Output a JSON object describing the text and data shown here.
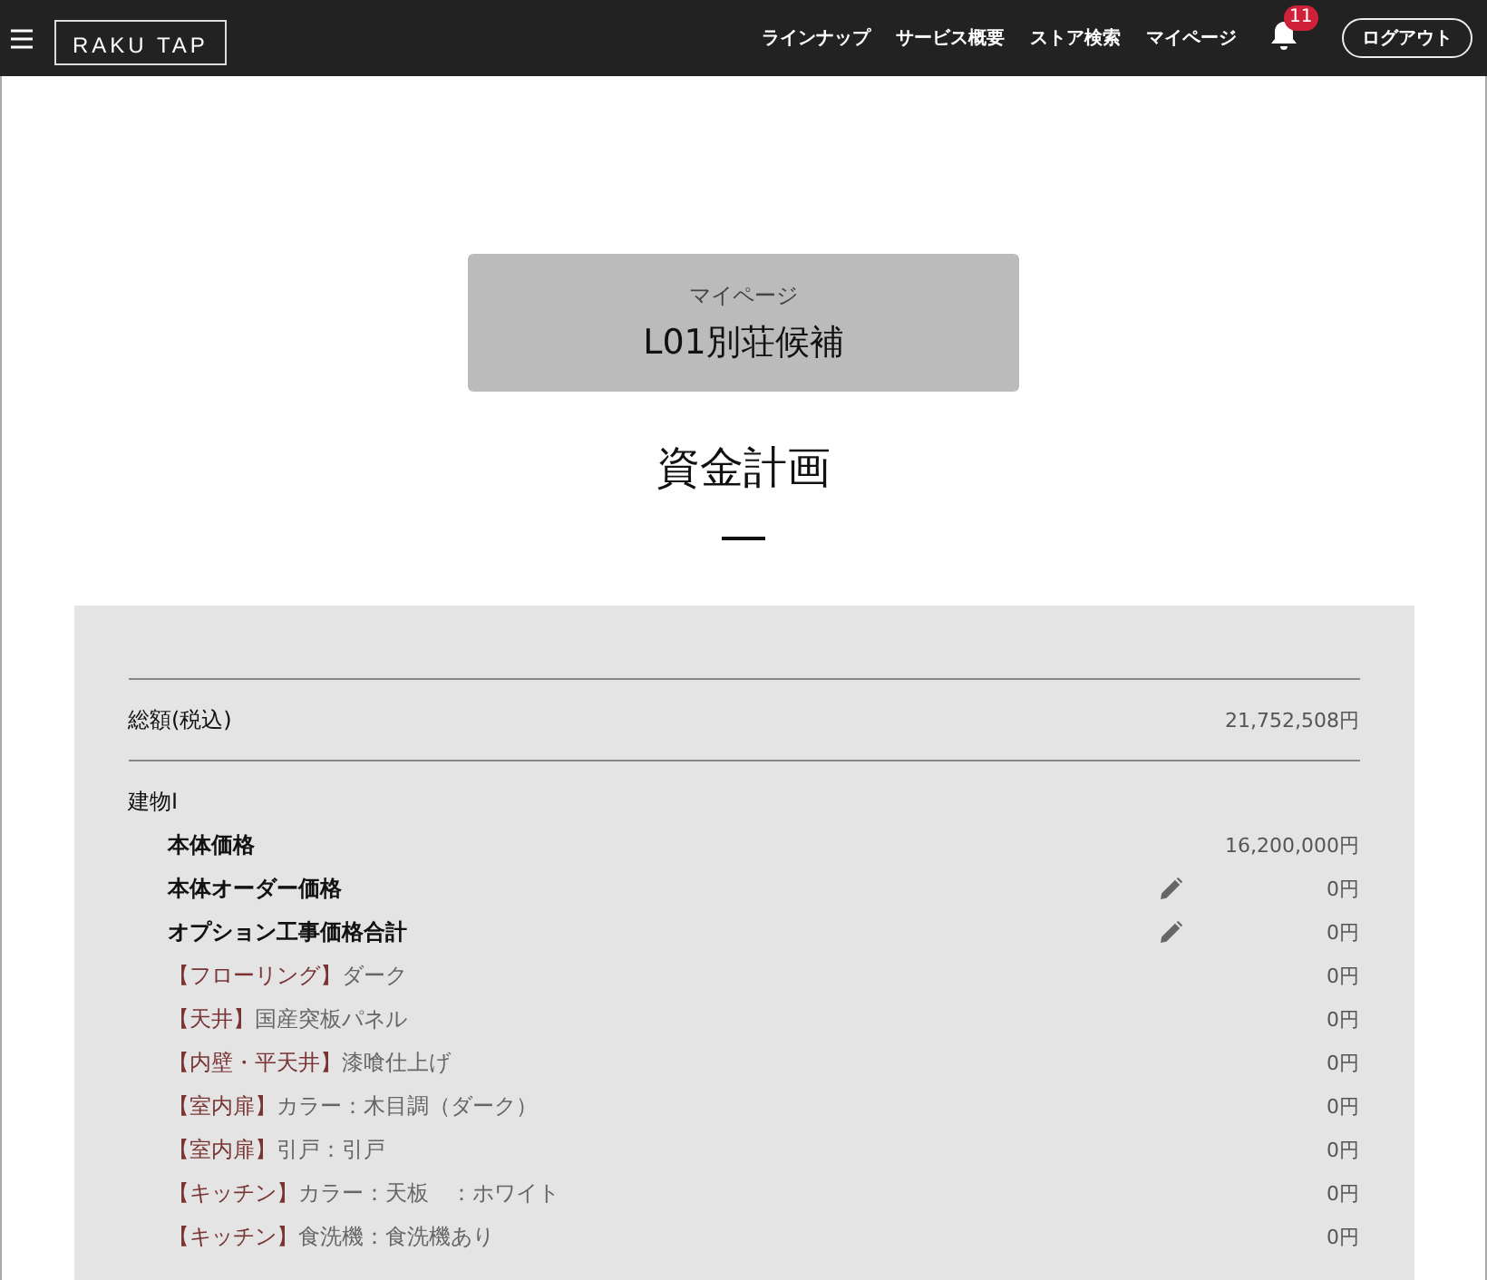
{
  "header": {
    "logo": "RAKU TAP",
    "nav": [
      "ラインナップ",
      "サービス概要",
      "ストア検索",
      "マイページ"
    ],
    "notification_count": "11",
    "logout": "ログアウト"
  },
  "card": {
    "caption": "マイページ",
    "title": "L01別荘候補"
  },
  "page_title": "資金計画",
  "rows": [
    {
      "kind": "total",
      "label": "総額(税込)",
      "amount": "21,752,508円"
    },
    {
      "kind": "section",
      "label": "建物Ⅰ"
    },
    {
      "kind": "item",
      "label": "本体価格",
      "amount": "16,200,000円",
      "editable": false
    },
    {
      "kind": "item",
      "label": "本体オーダー価格",
      "amount": "0円",
      "editable": true
    },
    {
      "kind": "item",
      "label": "オプション工事価格合計",
      "amount": "0円",
      "editable": true
    },
    {
      "kind": "option",
      "tag": "【フローリング】",
      "label": "ダーク",
      "amount": "0円"
    },
    {
      "kind": "option",
      "tag": "【天井】",
      "label": "国産突板パネル",
      "amount": "0円"
    },
    {
      "kind": "option",
      "tag": "【内壁・平天井】",
      "label": "漆喰仕上げ",
      "amount": "0円"
    },
    {
      "kind": "option",
      "tag": "【室内扉】",
      "label": "カラー：木目調（ダーク）",
      "amount": "0円"
    },
    {
      "kind": "option",
      "tag": "【室内扉】",
      "label": "引戸：引戸",
      "amount": "0円"
    },
    {
      "kind": "option",
      "tag": "【キッチン】",
      "label": "カラー：天板　：ホワイト",
      "amount": "0円"
    },
    {
      "kind": "option",
      "tag": "【キッチン】",
      "label": "食洗機：食洗機あり",
      "amount": "0円"
    }
  ]
}
